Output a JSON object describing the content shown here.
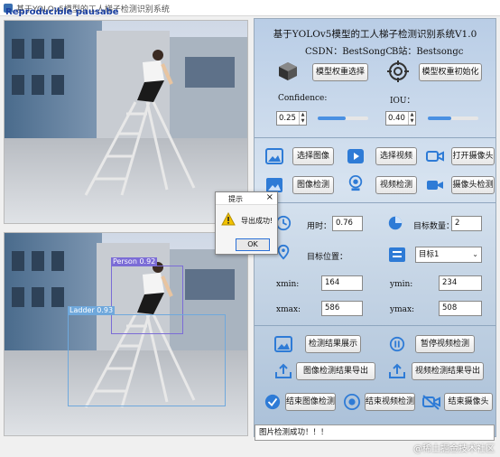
{
  "window": {
    "title": "基于YOLOv5模型的工人梯子检测识别系统",
    "overlay_text": "Reproducible pausabe"
  },
  "detections": [
    {
      "label": "Person",
      "score": "0.92",
      "color": "#7b6cd6"
    },
    {
      "label": "Ladder",
      "score": "0.93",
      "color": "#6fa8dc"
    }
  ],
  "header": {
    "title": "基于YOLOv5模型的工人梯子检测识别系统V1.0",
    "csdn": "CSDN：BestSongC",
    "bilibili": "B站：Bestsongc"
  },
  "model": {
    "select_label": "模型权重选择",
    "init_label": "模型权重初始化"
  },
  "params": {
    "confidence_label": "Confidence:",
    "confidence_value": "0.25",
    "iou_label": "IOU：",
    "iou_value": "0.40",
    "confidence_fraction": 0.25,
    "iou_fraction": 0.4
  },
  "source_buttons": {
    "select_image": "选择图像",
    "select_video": "选择视频",
    "open_camera": "打开摄像头",
    "image_detect": "图像检测",
    "video_detect": "视频检测",
    "camera_detect": "摄像头检测"
  },
  "results": {
    "time_label": "用时：",
    "time_value": "0.76",
    "count_label": "目标数量：",
    "count_value": "2",
    "position_label": "目标位置：",
    "target_select": "目标1",
    "xmin_label": "xmin:",
    "xmin_value": "164",
    "ymin_label": "ymin:",
    "ymin_value": "234",
    "xmax_label": "xmax:",
    "xmax_value": "586",
    "ymax_label": "ymax:",
    "ymax_value": "508"
  },
  "actions": {
    "show_results": "检测结果展示",
    "pause_video": "暂停视频检测",
    "export_image": "图像检测结果导出",
    "export_video": "视频检测结果导出",
    "end_image": "结束图像检测",
    "end_video": "结束视频检测",
    "end_camera": "结束摄像头"
  },
  "status": {
    "message": "图片检测成功！！！"
  },
  "dialog": {
    "title": "提示",
    "message": "导出成功!",
    "ok": "OK"
  },
  "watermark": "@稀土掘金技术社区"
}
